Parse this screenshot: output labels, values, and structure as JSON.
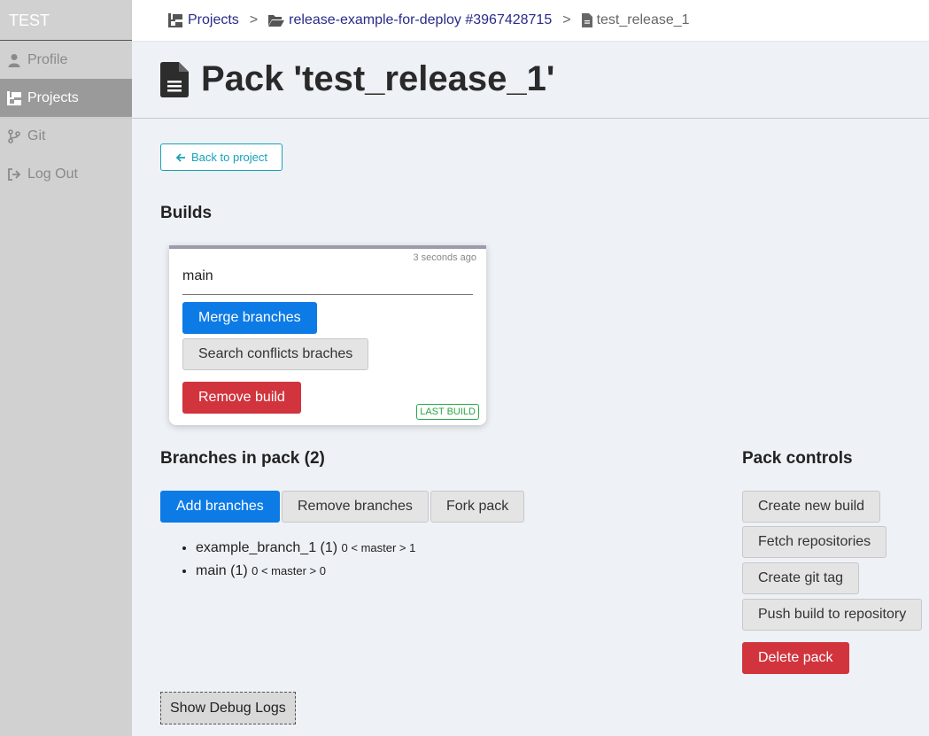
{
  "sidebar": {
    "brand": "TEST",
    "items": [
      {
        "label": "Profile",
        "icon": "user-icon"
      },
      {
        "label": "Projects",
        "icon": "projects-icon",
        "active": true
      },
      {
        "label": "Git",
        "icon": "git-branch-icon"
      },
      {
        "label": "Log Out",
        "icon": "logout-icon"
      }
    ]
  },
  "breadcrumb": {
    "projects": "Projects",
    "project": "release-example-for-deploy #3967428715",
    "pack": "test_release_1",
    "separator": ">"
  },
  "page": {
    "title": "Pack 'test_release_1'",
    "back_label": "Back to project"
  },
  "builds": {
    "heading": "Builds",
    "card": {
      "time": "3 seconds ago",
      "branch": "main",
      "merge_label": "Merge branches",
      "search_label": "Search conflicts braches",
      "remove_label": "Remove build",
      "badge": "LAST BUILD"
    }
  },
  "branches": {
    "heading": "Branches in pack (2)",
    "add_label": "Add branches",
    "remove_label": "Remove branches",
    "fork_label": "Fork pack",
    "items": [
      {
        "name": "example_branch_1 (1)",
        "meta": "0 < master > 1"
      },
      {
        "name": "main (1)",
        "meta": "0 < master > 0"
      }
    ]
  },
  "controls": {
    "heading": "Pack controls",
    "create_build": "Create new build",
    "fetch_repos": "Fetch repositories",
    "create_tag": "Create git tag",
    "push_build": "Push build to repository",
    "delete_pack": "Delete pack"
  },
  "debug": {
    "label": "Show Debug Logs"
  },
  "colors": {
    "primary": "#0d7be6",
    "danger": "#d1343d",
    "info": "#17a2b8",
    "success": "#28a745",
    "sidebar_bg": "#d1d1d1",
    "sidebar_active": "#9a9a9a"
  }
}
